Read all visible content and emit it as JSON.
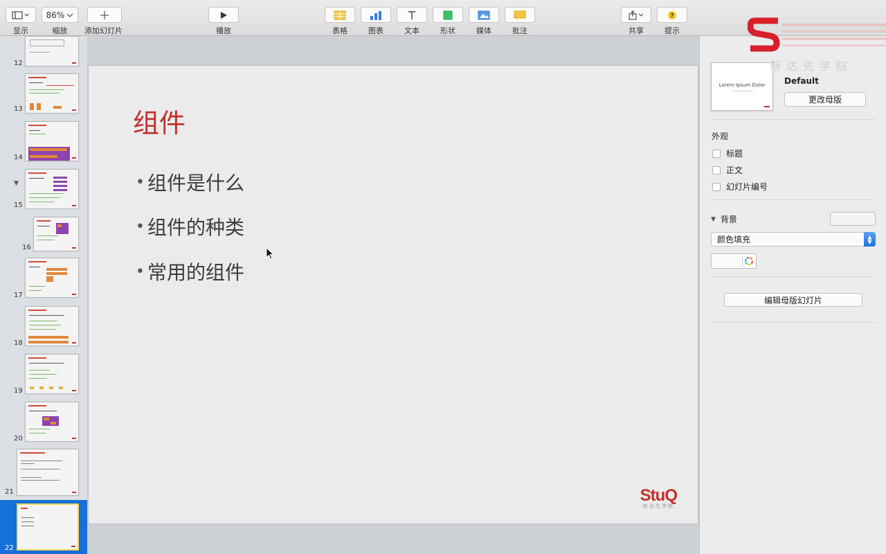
{
  "toolbar": {
    "view_label": "显示",
    "zoom_value": "86%",
    "zoom_label": "缩放",
    "add_slide_label": "添加幻灯片",
    "play_label": "播放",
    "table_label": "表格",
    "chart_label": "图表",
    "text_label": "文本",
    "shape_label": "形状",
    "media_label": "媒体",
    "comment_label": "批注",
    "share_label": "共享",
    "tips_label": "提示"
  },
  "navigator": {
    "slides": [
      "12",
      "13",
      "14",
      "15",
      "16",
      "17",
      "18",
      "19",
      "20",
      "21",
      "22"
    ],
    "selected": "22"
  },
  "slide": {
    "title": "组件",
    "bullets": [
      "组件是什么",
      "组件的种类",
      "常用的组件"
    ],
    "bullet_char": "•",
    "logo": "StuQ",
    "logo_sub": "新达先学院"
  },
  "inspector": {
    "master_preview_text": "Lorem Ipsum Dolor",
    "master_name": "Default",
    "change_master_label": "更改母版",
    "appearance_heading": "外观",
    "checkbox_title": "标题",
    "checkbox_body": "正文",
    "checkbox_slide_number": "幻灯片编号",
    "background_heading": "背景",
    "fill_type": "颜色填充",
    "edit_master_label": "编辑母版幻灯片"
  },
  "watermark": {
    "text": "新达先学院"
  },
  "colors": {
    "accent": "#c0302a",
    "selection": "#1670d9",
    "select_blue": "#1f6fe0"
  }
}
